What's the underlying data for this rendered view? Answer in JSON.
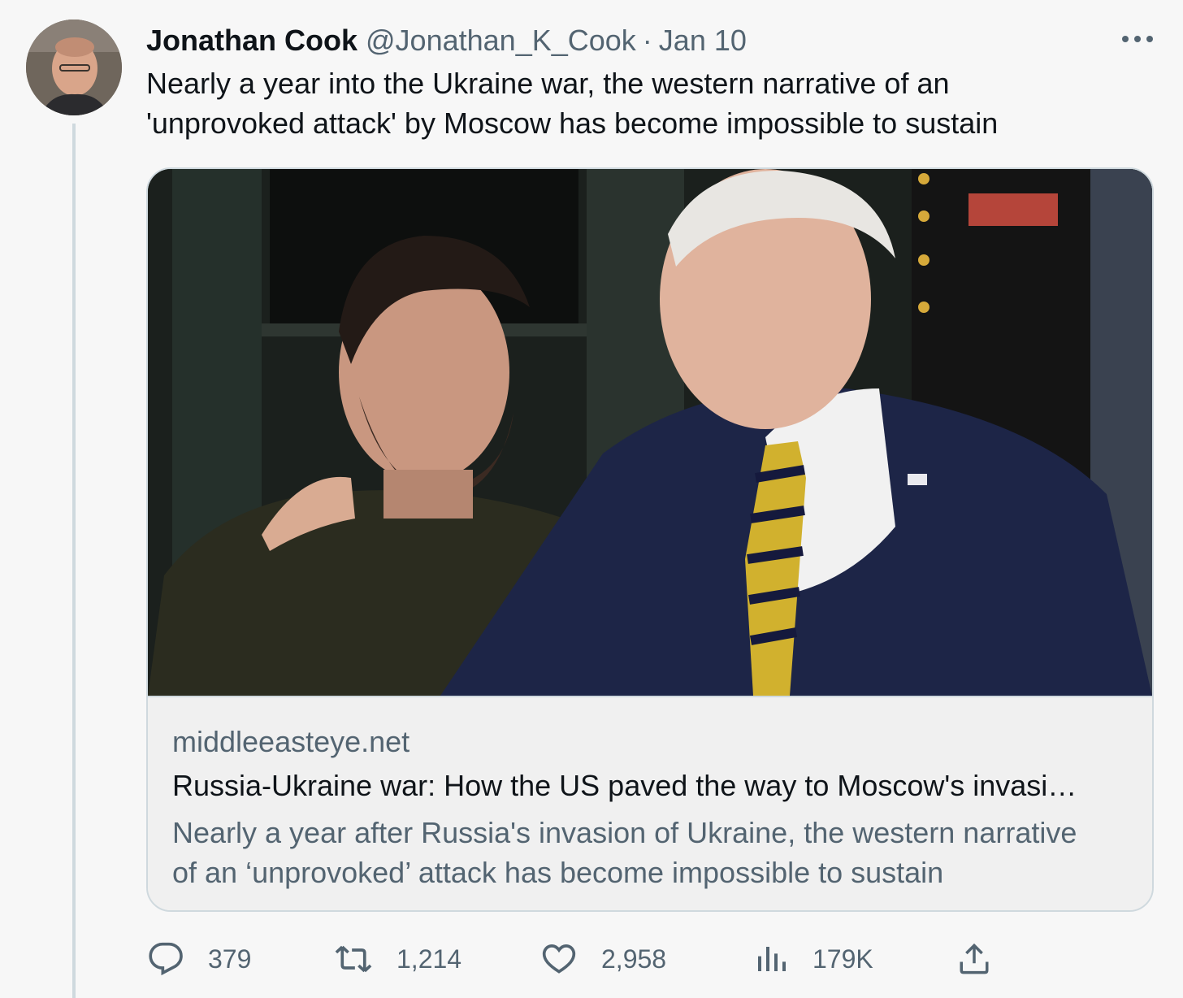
{
  "author": {
    "name": "Jonathan Cook",
    "handle": "@Jonathan_K_Cook",
    "separator": "·",
    "date": "Jan 10"
  },
  "tweet": {
    "text_lines": [
      "Nearly a year into the Ukraine war, the western narrative of an",
      "'unprovoked attack' by Moscow has become impossible to sustain"
    ]
  },
  "card": {
    "domain": "middleeasteye.net",
    "title": "Russia-Ukraine war: How the US paved the way to Moscow's invasi…",
    "description_lines": [
      "Nearly a year after Russia's invasion of Ukraine, the western narrative",
      "of an ‘unprovoked’ attack has become impossible to sustain"
    ]
  },
  "actions": {
    "replies": "379",
    "retweets": "1,214",
    "likes": "2,958",
    "views": "179K"
  },
  "icons": {
    "more": "more-icon",
    "reply": "reply-icon",
    "retweet": "retweet-icon",
    "like": "heart-icon",
    "views": "views-icon",
    "share": "share-icon"
  },
  "colors": {
    "text": "#0f1419",
    "secondary": "#536471",
    "border": "#cfd9de",
    "background": "#f7f7f7"
  }
}
